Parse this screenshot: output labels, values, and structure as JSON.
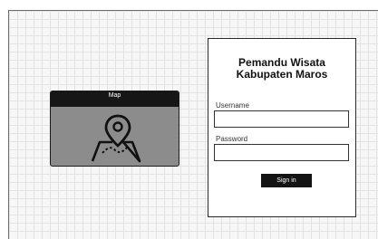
{
  "map": {
    "title": "Map",
    "icon": "map-pin-icon"
  },
  "login": {
    "title_line1": "Pemandu Wisata",
    "title_line2": "Kabupaten Maros",
    "username_label": "Username",
    "username_value": "",
    "password_label": "Password",
    "password_value": "",
    "signin_label": "Sign in"
  },
  "colors": {
    "canvas_grid": "#e3e3e3",
    "map_header": "#161616",
    "map_body": "#8c8c8c",
    "button": "#141414"
  }
}
